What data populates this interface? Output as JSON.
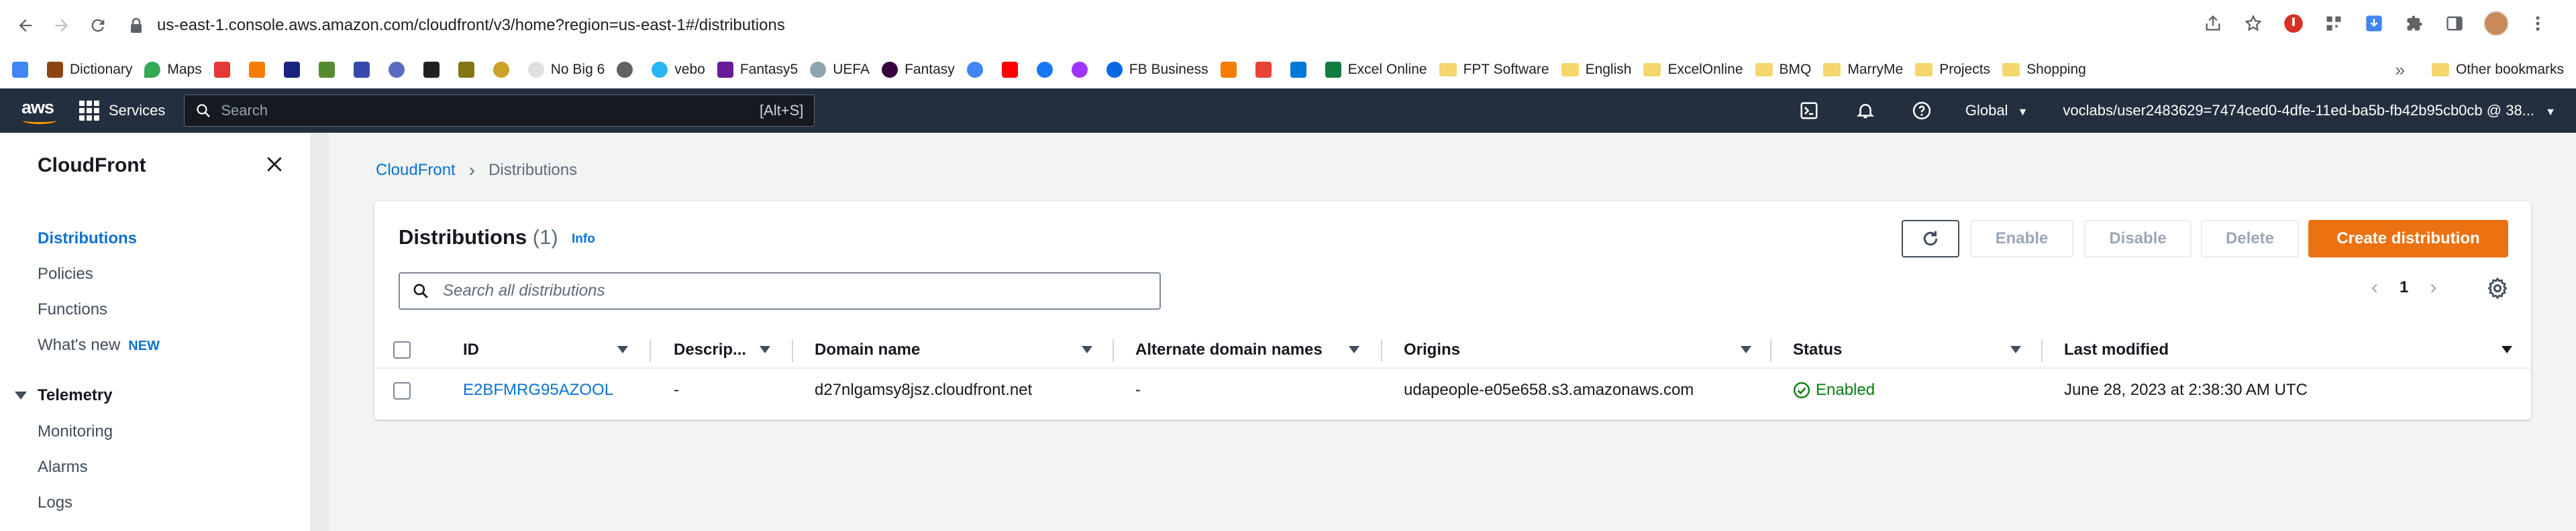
{
  "browser": {
    "url": "us-east-1.console.aws.amazon.com/cloudfront/v3/home?region=us-east-1#/distributions",
    "bookmarks": [
      "Dictionary",
      "Maps",
      "No Big 6",
      "vebo",
      "Fantasy5",
      "UEFA",
      "Fantasy",
      "FB Business",
      "Excel Online",
      "FPT Software",
      "English",
      "ExcelOnline",
      "BMQ",
      "MarryMe",
      "Projects",
      "Shopping"
    ],
    "more_bookmarks": "»",
    "other_bookmarks": "Other bookmarks"
  },
  "aws_nav": {
    "logo": "aws",
    "services": "Services",
    "search_placeholder": "Search",
    "search_shortcut": "[Alt+S]",
    "region": "Global",
    "account": "voclabs/user2483629=7474ced0-4dfe-11ed-ba5b-fb42b95cb0cb @ 38..."
  },
  "sidebar": {
    "title": "CloudFront",
    "items": [
      "Distributions",
      "Policies",
      "Functions",
      "What's new"
    ],
    "new_badge": "NEW",
    "section": "Telemetry",
    "section_items": [
      "Monitoring",
      "Alarms",
      "Logs"
    ]
  },
  "breadcrumb": {
    "root": "CloudFront",
    "current": "Distributions"
  },
  "panel": {
    "title": "Distributions",
    "count": "(1)",
    "info": "Info",
    "buttons": {
      "enable": "Enable",
      "disable": "Disable",
      "delete": "Delete",
      "create": "Create distribution"
    },
    "search_placeholder": "Search all distributions",
    "page": "1",
    "columns": [
      "ID",
      "Descrip...",
      "Domain name",
      "Alternate domain names",
      "Origins",
      "Status",
      "Last modified"
    ],
    "rows": [
      {
        "id": "E2BFMRG95AZOOL",
        "description": "-",
        "domain": "d27nlgamsy8jsz.cloudfront.net",
        "alternate": "-",
        "origins": "udapeople-e05e658.s3.amazonaws.com",
        "status": "Enabled",
        "last_modified": "June 28, 2023 at 2:38:30 AM UTC"
      }
    ]
  },
  "colors": {
    "accent": "#ec7211",
    "link": "#0972d3",
    "nav_bg": "#232f3e",
    "success": "#037f0c"
  }
}
